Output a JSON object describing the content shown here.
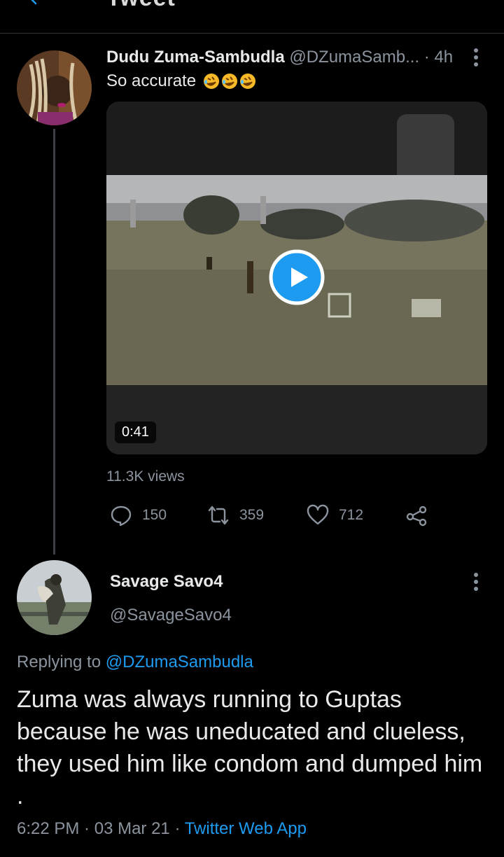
{
  "header": {
    "title": "Tweet"
  },
  "quoted_tweet": {
    "author_name": "Dudu Zuma-Sambudla",
    "handle": "@DZumaSamb...",
    "separator": "·",
    "time": "4h",
    "text": "So accurate",
    "emojis": [
      "rolling-on-floor-laughing-emoji",
      "rolling-on-floor-laughing-emoji",
      "rolling-on-floor-laughing-emoji"
    ],
    "video": {
      "duration": "0:41"
    },
    "views": "11.3K views",
    "actions": {
      "replies": "150",
      "retweets": "359",
      "likes": "712"
    }
  },
  "reply": {
    "author_name": "Savage Savo4",
    "handle": "@SavageSavo4",
    "replying_prefix": "Replying to ",
    "replying_to": "@DZumaSambudla",
    "text": "Zuma was always running to Guptas because he was uneducated and clueless, they used him like condom and dumped him .",
    "time": "6:22 PM",
    "separator1": " · ",
    "date": "03 Mar 21",
    "separator2": " · ",
    "source": "Twitter Web App"
  },
  "colors": {
    "accent": "#1d9bf0",
    "background": "#000000",
    "muted": "#8b949e"
  }
}
